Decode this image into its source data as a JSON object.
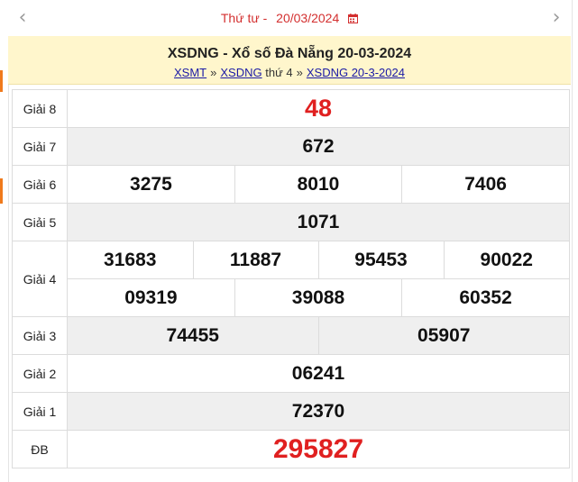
{
  "nav": {
    "prev_arrow": "‹",
    "next_arrow": "›",
    "day_label": "Thứ tư -",
    "date": "20/03/2024"
  },
  "header": {
    "title": "XSDNG - Xổ số Đà Nẵng 20-03-2024",
    "crumb_1": "XSMT",
    "sep": "»",
    "crumb_2": "XSDNG",
    "crumb_2_suffix": "thứ 4",
    "crumb_3": "XSDNG 20-3-2024"
  },
  "prizes": {
    "g8": {
      "label": "Giải 8",
      "numbers": [
        "48"
      ]
    },
    "g7": {
      "label": "Giải 7",
      "numbers": [
        "672"
      ]
    },
    "g6": {
      "label": "Giải 6",
      "numbers": [
        "3275",
        "8010",
        "7406"
      ]
    },
    "g5": {
      "label": "Giải 5",
      "numbers": [
        "1071"
      ]
    },
    "g4": {
      "label": "Giải 4",
      "row1": [
        "31683",
        "11887",
        "95453",
        "90022"
      ],
      "row2": [
        "09319",
        "39088",
        "60352"
      ]
    },
    "g3": {
      "label": "Giải 3",
      "numbers": [
        "74455",
        "05907"
      ]
    },
    "g2": {
      "label": "Giải 2",
      "numbers": [
        "06241"
      ]
    },
    "g1": {
      "label": "Giải 1",
      "numbers": [
        "72370"
      ]
    },
    "db": {
      "label": "ĐB",
      "numbers": [
        "295827"
      ]
    }
  },
  "colors": {
    "accent_red": "#e02020",
    "date_red": "#d32f2f",
    "header_bg": "#fff6cc",
    "link_blue": "#1a1aa6",
    "row_gray": "#efefef"
  }
}
